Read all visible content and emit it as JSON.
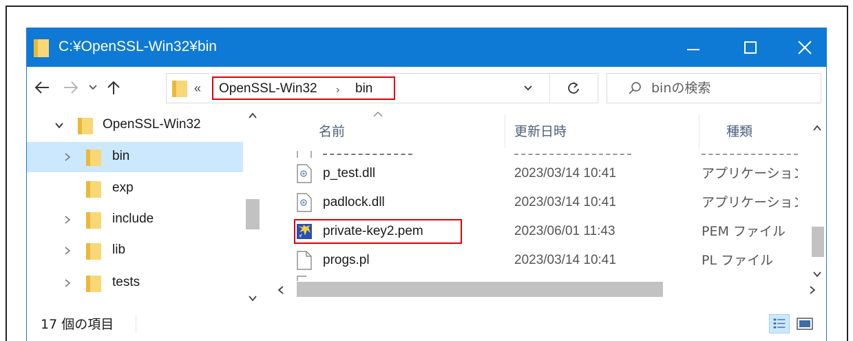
{
  "window": {
    "title": "C:¥OpenSSL-Win32¥bin",
    "controls": {
      "minimize": "minimize",
      "maximize": "maximize",
      "close": "close"
    }
  },
  "address": {
    "overflow": "«",
    "crumbs": [
      "OpenSSL-Win32",
      "bin"
    ],
    "separator": "›"
  },
  "search": {
    "placeholder": "binの検索"
  },
  "nav_tree": [
    {
      "label": "OpenSSL-Win32",
      "expanded": true
    },
    {
      "label": "bin",
      "selected": true
    },
    {
      "label": "exp"
    },
    {
      "label": "include"
    },
    {
      "label": "lib"
    },
    {
      "label": "tests"
    }
  ],
  "columns": {
    "name": "名前",
    "date": "更新日時",
    "type": "種類"
  },
  "files": [
    {
      "name": "p_test.dll",
      "date": "2023/03/14 10:41",
      "type": "アプリケーション拡張",
      "icon": "dll-file-icon"
    },
    {
      "name": "padlock.dll",
      "date": "2023/03/14 10:41",
      "type": "アプリケーション拡張",
      "icon": "dll-file-icon"
    },
    {
      "name": "private-key2.pem",
      "date": "2023/06/01 11:43",
      "type": "PEM ファイル",
      "icon": "pem-file-icon",
      "highlighted": true
    },
    {
      "name": "progs.pl",
      "date": "2023/03/14 10:41",
      "type": "PL ファイル",
      "icon": "blank-file-icon"
    }
  ],
  "status": {
    "item_count": "17 個の項目"
  },
  "colors": {
    "titlebar": "#0e7ad6",
    "selection": "#cce8ff",
    "highlight_box": "#e00000",
    "folder": "#f8d775"
  }
}
